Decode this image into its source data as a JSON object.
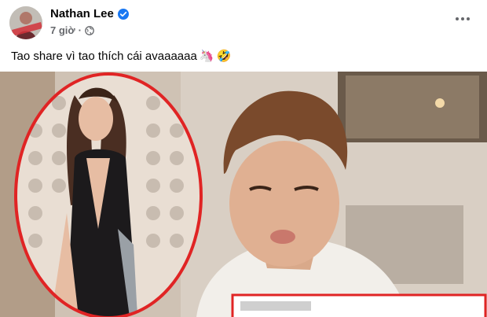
{
  "post": {
    "author": "Nathan Lee",
    "time": "7 giờ",
    "separator": "·",
    "caption": "Tao share vì tao thích cái avaaaaaa",
    "emoji": [
      "🦄",
      "🤣"
    ]
  },
  "icons": {
    "verified": "verified-badge-icon",
    "audience": "globe-icon",
    "more": "more-options-icon"
  },
  "colors": {
    "verified_blue": "#1877f2",
    "meta_gray": "#65676b",
    "highlight_red": "#e02424"
  }
}
